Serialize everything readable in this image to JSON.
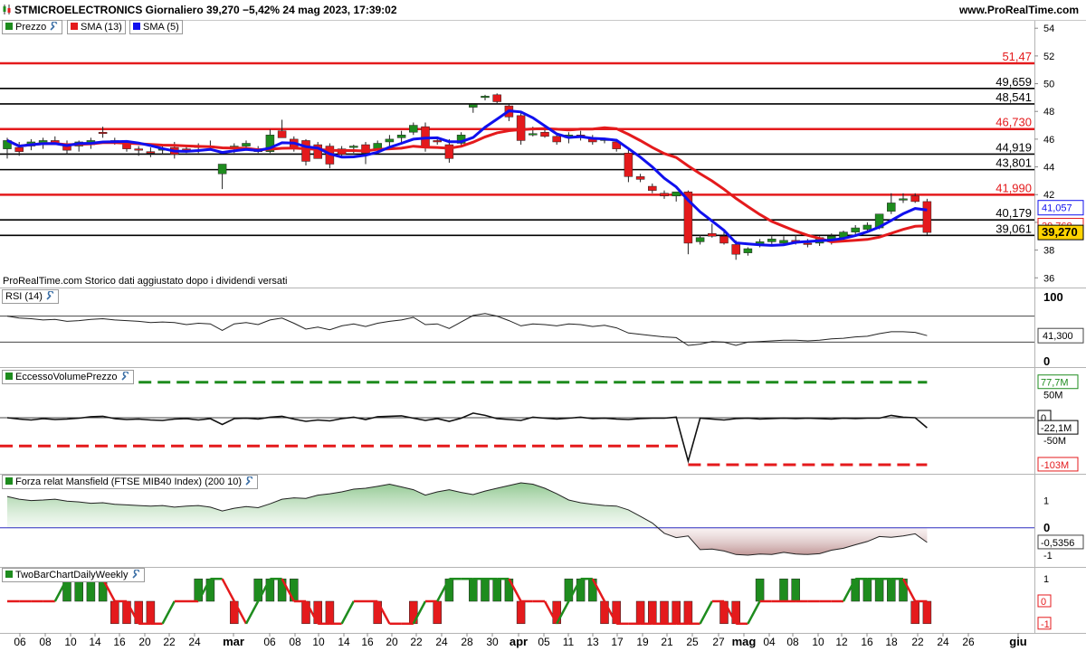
{
  "header": {
    "title": "STMICROELECTRONICS Giornaliero 39,270 −5,42% 24 mag 2023, 17:39:02",
    "site": "www.ProRealTime.com"
  },
  "price_panel": {
    "legend": [
      {
        "label": "Prezzo",
        "color": "#1e8c1e"
      },
      {
        "label": "SMA (13)",
        "color": "#e41a1c"
      },
      {
        "label": "SMA (5)",
        "color": "#1010ee"
      }
    ],
    "note": "ProRealTime.com Storico dati aggiustato dopo i dividendi versati"
  },
  "rsi_panel": {
    "label": "RSI (14)"
  },
  "volume_panel": {
    "label": "EccessoVolumePrezzo"
  },
  "mansfield_panel": {
    "label": "Forza relat Mansfield (FTSE MIB40 Index) (200 10)"
  },
  "twobar_panel": {
    "label": "TwoBarChartDailyWeekly"
  },
  "colors": {
    "up": "#1e8c1e",
    "down": "#e41a1c",
    "sma13": "#e41a1c",
    "sma5": "#1010ee",
    "level_black": "#000000",
    "level_red": "#e41a1c"
  },
  "chart_data": [
    {
      "type": "candlestick",
      "title": "STMICROELECTRONICS Giornaliero",
      "x_ticks": [
        "06",
        "08",
        "10",
        "14",
        "16",
        "20",
        "22",
        "24",
        "mar",
        "06",
        "08",
        "10",
        "14",
        "16",
        "20",
        "22",
        "24",
        "28",
        "30",
        "apr",
        "05",
        "11",
        "13",
        "17",
        "19",
        "21",
        "25",
        "27",
        "mag",
        "04",
        "08",
        "10",
        "12",
        "16",
        "18",
        "22",
        "24",
        "26",
        "giu"
      ],
      "y_ticks": [
        "36",
        "38",
        "40",
        "42",
        "44",
        "46",
        "48",
        "50",
        "52",
        "54"
      ],
      "ylim": [
        35.3,
        54.6
      ],
      "last_value": "39,270",
      "levels": [
        {
          "value": 51.47,
          "label": "51,47",
          "color": "red"
        },
        {
          "value": 49.659,
          "label": "49,659",
          "color": "black"
        },
        {
          "value": 48.541,
          "label": "48,541",
          "color": "black"
        },
        {
          "value": 46.73,
          "label": "46,730",
          "color": "red"
        },
        {
          "value": 44.919,
          "label": "44,919",
          "color": "black"
        },
        {
          "value": 43.801,
          "label": "43,801",
          "color": "black"
        },
        {
          "value": 41.99,
          "label": "41,990",
          "color": "red"
        },
        {
          "value": 40.179,
          "label": "40,179",
          "color": "black"
        },
        {
          "value": 39.061,
          "label": "39,061",
          "color": "black"
        }
      ],
      "badges": [
        {
          "value": 41.057,
          "label": "41,057",
          "series": "SMA (5)"
        },
        {
          "value": 39.768,
          "label": "39,768",
          "series": "SMA (13)"
        },
        {
          "value": 39.27,
          "label": "39,270",
          "series": "Prezzo"
        }
      ],
      "candles": [
        [
          45.3,
          46.1,
          44.6,
          45.9
        ],
        [
          45.4,
          45.8,
          44.8,
          45.1
        ],
        [
          45.5,
          46.0,
          45.2,
          45.8
        ],
        [
          45.6,
          46.1,
          45.3,
          45.9
        ],
        [
          45.9,
          46.2,
          45.6,
          45.7
        ],
        [
          45.6,
          45.9,
          44.9,
          45.2
        ],
        [
          45.5,
          45.9,
          45.1,
          45.8
        ],
        [
          45.6,
          46.1,
          45.3,
          45.9
        ],
        [
          46.5,
          46.9,
          46.1,
          46.4
        ],
        [
          45.9,
          46.1,
          45.6,
          45.8
        ],
        [
          45.7,
          45.9,
          45.1,
          45.3
        ],
        [
          45.3,
          45.5,
          44.8,
          45.2
        ],
        [
          45.1,
          45.4,
          44.7,
          45.0
        ],
        [
          45.2,
          45.6,
          44.9,
          45.3
        ],
        [
          45.4,
          45.8,
          44.6,
          44.9
        ],
        [
          45.3,
          45.5,
          45.0,
          45.2
        ],
        [
          45.4,
          45.7,
          45.0,
          45.5
        ],
        [
          45.5,
          45.9,
          45.2,
          45.4
        ],
        [
          43.5,
          44.0,
          42.4,
          44.2
        ],
        [
          45.4,
          45.7,
          45.0,
          45.5
        ],
        [
          45.5,
          45.9,
          45.2,
          45.7
        ],
        [
          45.3,
          45.5,
          45.0,
          45.1
        ],
        [
          45.1,
          46.7,
          45.0,
          46.3
        ],
        [
          46.6,
          47.4,
          46.2,
          46.1
        ],
        [
          46.0,
          46.2,
          45.1,
          45.4
        ],
        [
          45.9,
          46.0,
          44.1,
          44.4
        ],
        [
          45.6,
          45.8,
          44.6,
          44.6
        ],
        [
          45.5,
          45.7,
          43.9,
          44.2
        ],
        [
          45.3,
          45.5,
          44.7,
          44.9
        ],
        [
          45.4,
          45.6,
          45.0,
          45.5
        ],
        [
          45.6,
          45.8,
          44.2,
          45.0
        ],
        [
          45.3,
          45.9,
          44.9,
          45.7
        ],
        [
          45.8,
          46.3,
          45.4,
          46.0
        ],
        [
          46.1,
          46.6,
          45.7,
          46.3
        ],
        [
          46.5,
          47.2,
          46.3,
          47.0
        ],
        [
          46.9,
          47.2,
          45.1,
          45.4
        ],
        [
          45.9,
          46.1,
          45.6,
          45.8
        ],
        [
          45.6,
          46.0,
          44.3,
          44.6
        ],
        [
          45.7,
          46.5,
          45.5,
          46.3
        ],
        [
          48.3,
          48.6,
          47.9,
          48.5
        ],
        [
          49.0,
          49.2,
          48.8,
          49.1
        ],
        [
          49.2,
          49.3,
          48.5,
          48.7
        ],
        [
          48.4,
          48.6,
          47.3,
          47.6
        ],
        [
          47.7,
          48.0,
          45.6,
          45.9
        ],
        [
          46.4,
          46.9,
          46.2,
          46.4
        ],
        [
          46.5,
          46.7,
          46.1,
          46.2
        ],
        [
          46.2,
          46.4,
          45.6,
          45.8
        ],
        [
          46.1,
          46.5,
          45.7,
          46.3
        ],
        [
          46.3,
          46.6,
          45.9,
          46.2
        ],
        [
          46.1,
          46.3,
          45.6,
          45.8
        ],
        [
          45.9,
          46.1,
          45.7,
          46.0
        ],
        [
          45.8,
          46.0,
          45.1,
          45.3
        ],
        [
          45.0,
          45.4,
          42.9,
          43.3
        ],
        [
          43.3,
          43.5,
          42.9,
          43.1
        ],
        [
          42.6,
          42.8,
          42.1,
          42.3
        ],
        [
          42.1,
          42.3,
          41.7,
          41.9
        ],
        [
          41.9,
          42.1,
          41.5,
          42.2
        ],
        [
          42.2,
          42.3,
          37.7,
          38.5
        ],
        [
          38.6,
          39.1,
          38.4,
          38.9
        ],
        [
          39.2,
          39.9,
          38.9,
          39.0
        ],
        [
          39.0,
          39.4,
          38.4,
          38.5
        ],
        [
          38.4,
          38.7,
          37.3,
          37.7
        ],
        [
          37.8,
          38.2,
          37.6,
          38.1
        ],
        [
          38.4,
          38.8,
          38.2,
          38.6
        ],
        [
          38.6,
          39.0,
          38.4,
          38.8
        ],
        [
          38.5,
          39.0,
          38.3,
          38.7
        ],
        [
          38.7,
          39.1,
          38.4,
          38.6
        ],
        [
          38.5,
          38.8,
          38.2,
          38.4
        ],
        [
          38.5,
          39.0,
          38.3,
          38.9
        ],
        [
          38.6,
          39.2,
          38.4,
          39.0
        ],
        [
          38.9,
          39.4,
          38.7,
          39.3
        ],
        [
          39.3,
          39.8,
          39.1,
          39.6
        ],
        [
          39.5,
          40.0,
          39.3,
          39.8
        ],
        [
          39.6,
          40.6,
          39.5,
          40.6
        ],
        [
          40.8,
          42.1,
          40.6,
          41.4
        ],
        [
          41.6,
          42.1,
          41.4,
          41.7
        ],
        [
          41.9,
          42.1,
          41.4,
          41.5
        ],
        [
          41.5,
          41.7,
          39.1,
          39.27
        ]
      ]
    },
    {
      "type": "line",
      "title": "RSI (14)",
      "ylim": [
        0,
        100
      ],
      "y_ticks": [
        "0",
        "100"
      ],
      "last_value": "41,300",
      "values": [
        70,
        67,
        66,
        64,
        65,
        62,
        63,
        65,
        66,
        64,
        63,
        62,
        60,
        61,
        60,
        57,
        59,
        58,
        48,
        58,
        60,
        57,
        64,
        67,
        59,
        50,
        53,
        49,
        55,
        58,
        54,
        59,
        62,
        64,
        68,
        57,
        58,
        51,
        61,
        71,
        74,
        70,
        63,
        55,
        58,
        57,
        55,
        58,
        57,
        54,
        56,
        52,
        44,
        42,
        40,
        38,
        37,
        25,
        27,
        31,
        30,
        25,
        30,
        31,
        32,
        33,
        33,
        32,
        33,
        35,
        36,
        38,
        39,
        43,
        46,
        46,
        45,
        40
      ]
    },
    {
      "type": "line",
      "title": "EccessoVolumePrezzo",
      "ylim": [
        -115,
        95
      ],
      "y_ticks": [
        "50M",
        "0",
        "-50M"
      ],
      "badges": [
        {
          "value": 77.7,
          "label": "77,7M"
        },
        {
          "value": 0,
          "label": "0"
        },
        {
          "value": -22.1,
          "label": "-22,1M"
        },
        {
          "value": -103,
          "label": "-103M"
        }
      ],
      "values": [
        0,
        -3,
        -5,
        -2,
        -4,
        -3,
        -1,
        2,
        3,
        -2,
        -4,
        -3,
        -5,
        -6,
        -3,
        -2,
        -5,
        -2,
        -15,
        -2,
        -1,
        -3,
        1,
        3,
        -3,
        -8,
        -5,
        -7,
        -2,
        1,
        -4,
        2,
        3,
        4,
        -1,
        -6,
        -2,
        -8,
        -1,
        10,
        5,
        -2,
        -4,
        -6,
        1,
        -1,
        -3,
        -1,
        1,
        -2,
        -1,
        -3,
        -4,
        -2,
        -1,
        -1,
        1,
        -95,
        -1,
        -3,
        -5,
        -2,
        -1,
        -3,
        -2,
        -1,
        -2,
        -1,
        -2,
        -3,
        -1,
        -2,
        -1,
        -1,
        5,
        1,
        0,
        -22.1
      ],
      "dashed_lines": [
        {
          "value": 77.7,
          "color": "#1e8c1e"
        },
        {
          "value": -62,
          "color": "#e41a1c",
          "until_bar": 56
        },
        {
          "value": -103,
          "color": "#e41a1c",
          "from_bar": 57
        }
      ]
    },
    {
      "type": "area",
      "title": "Forza relat Mansfield (FTSE MIB40 Index) (200 10)",
      "ylim": [
        -1.3,
        1.75
      ],
      "y_ticks": [
        "1",
        "0",
        "-1"
      ],
      "last_value": "-0,5356",
      "values": [
        1.15,
        1.05,
        1.0,
        1.02,
        1.05,
        0.98,
        0.95,
        0.9,
        0.92,
        0.86,
        0.84,
        0.82,
        0.8,
        0.82,
        0.76,
        0.8,
        0.82,
        0.76,
        0.62,
        0.72,
        0.78,
        0.74,
        0.88,
        1.05,
        1.1,
        1.08,
        1.2,
        1.25,
        1.32,
        1.42,
        1.45,
        1.52,
        1.6,
        1.5,
        1.4,
        1.2,
        1.32,
        1.4,
        1.3,
        1.22,
        1.35,
        1.45,
        1.55,
        1.65,
        1.6,
        1.45,
        1.25,
        1.02,
        0.92,
        0.86,
        0.82,
        0.8,
        0.66,
        0.42,
        0.18,
        -0.2,
        -0.36,
        -0.3,
        -0.8,
        -0.78,
        -0.85,
        -0.98,
        -1.0,
        -0.96,
        -0.98,
        -0.9,
        -0.96,
        -0.98,
        -0.95,
        -0.82,
        -0.75,
        -0.62,
        -0.5,
        -0.32,
        -0.35,
        -0.3,
        -0.22,
        -0.5356
      ]
    },
    {
      "type": "bar",
      "title": "TwoBarChartDailyWeekly",
      "ylim": [
        -1.25,
        1.25
      ],
      "y_ticks": [
        "1",
        "0",
        "-1"
      ],
      "badges": [
        {
          "value": 0,
          "label": "0"
        },
        {
          "value": -1,
          "label": "-1"
        }
      ],
      "values": [
        0,
        0,
        0,
        0,
        0,
        1,
        1,
        1,
        1,
        -1,
        -1,
        -1,
        -1,
        0,
        0,
        0,
        1,
        1,
        0,
        -1,
        0,
        1,
        1,
        1,
        1,
        -1,
        -1,
        -1,
        0,
        0,
        0,
        -1,
        0,
        0,
        -1,
        0,
        -1,
        1,
        0,
        1,
        1,
        1,
        1,
        -1,
        0,
        0,
        -1,
        1,
        1,
        1,
        -1,
        -1,
        0,
        -1,
        -1,
        -1,
        -1,
        -1,
        0,
        0,
        -1,
        -1,
        0,
        1,
        0,
        1,
        1,
        0,
        0,
        0,
        0,
        1,
        1,
        1,
        1,
        1,
        -1,
        -1
      ],
      "step_line": [
        0,
        0,
        0,
        0,
        0,
        1,
        1,
        1,
        1,
        0,
        0,
        -1,
        -1,
        -1,
        0,
        0,
        0,
        1,
        1,
        0,
        -1,
        0,
        1,
        1,
        0,
        0,
        -1,
        -1,
        -1,
        0,
        0,
        0,
        -1,
        -1,
        -1,
        0,
        0,
        1,
        1,
        1,
        1,
        1,
        1,
        0,
        0,
        0,
        -1,
        0,
        1,
        1,
        0,
        -1,
        -1,
        -1,
        -1,
        -1,
        -1,
        -1,
        -1,
        0,
        0,
        -1,
        -1,
        0,
        0,
        0,
        0,
        0,
        0,
        0,
        0,
        1,
        1,
        1,
        1,
        1,
        0,
        0
      ]
    }
  ]
}
